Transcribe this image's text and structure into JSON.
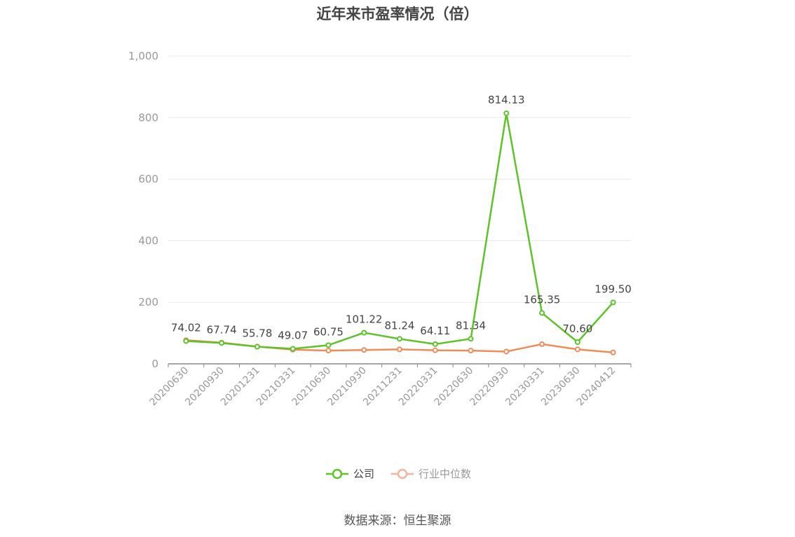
{
  "header": {
    "title": "近年来市盈率情况（倍）"
  },
  "footer": {
    "source": "数据来源：恒生聚源"
  },
  "colors": {
    "company": "#5dc328",
    "industry": "#f08c5a",
    "legend_industry": "#f5b49a",
    "grid": "#e6e8f0",
    "axis": "#888888"
  },
  "chart_data": {
    "type": "line",
    "title": "近年来市盈率情况（倍）",
    "xlabel": "",
    "ylabel": "",
    "ylim": [
      0,
      1000
    ],
    "yticks": [
      0,
      200,
      400,
      600,
      800,
      1000
    ],
    "ytick_labels": [
      "0",
      "200",
      "400",
      "600",
      "800",
      "1,000"
    ],
    "grid": true,
    "legend_position": "bottom-center",
    "categories": [
      "20200630",
      "20200930",
      "20201231",
      "20210331",
      "20210630",
      "20210930",
      "20211231",
      "20220331",
      "20220630",
      "20220930",
      "20230331",
      "20230630",
      "20240412"
    ],
    "series": [
      {
        "name": "公司",
        "color": "#5dc328",
        "values": [
          74.02,
          67.74,
          55.78,
          49.07,
          60.75,
          101.22,
          81.24,
          64.11,
          81.34,
          814.13,
          165.35,
          70.6,
          199.5
        ],
        "labels": [
          "74.02",
          "67.74",
          "55.78",
          "49.07",
          "60.75",
          "101.22",
          "81.24",
          "64.11",
          "81.34",
          "814.13",
          "165.35",
          "70.60",
          "199.50"
        ]
      },
      {
        "name": "行业中位数",
        "color": "#f08c5a",
        "values": [
          77,
          69,
          56,
          46,
          43,
          45,
          47,
          44,
          43,
          40,
          64,
          47,
          37
        ]
      }
    ]
  }
}
